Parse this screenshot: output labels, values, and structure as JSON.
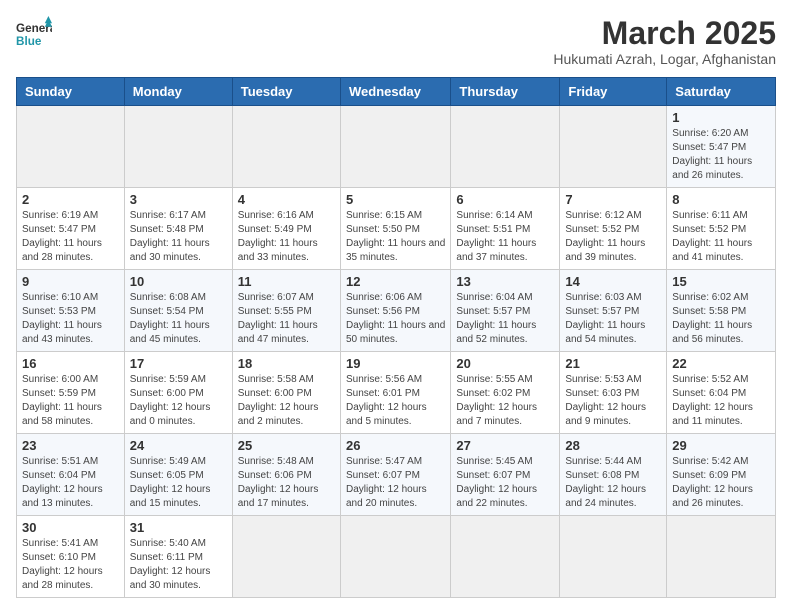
{
  "logo": {
    "text_general": "General",
    "text_blue": "Blue"
  },
  "header": {
    "month_title": "March 2025",
    "subtitle": "Hukumati Azrah, Logar, Afghanistan"
  },
  "weekdays": [
    "Sunday",
    "Monday",
    "Tuesday",
    "Wednesday",
    "Thursday",
    "Friday",
    "Saturday"
  ],
  "weeks": [
    [
      {
        "date": "",
        "info": ""
      },
      {
        "date": "",
        "info": ""
      },
      {
        "date": "",
        "info": ""
      },
      {
        "date": "",
        "info": ""
      },
      {
        "date": "",
        "info": ""
      },
      {
        "date": "",
        "info": ""
      },
      {
        "date": "1",
        "info": "Sunrise: 6:20 AM\nSunset: 5:47 PM\nDaylight: 11 hours and 26 minutes."
      }
    ],
    [
      {
        "date": "2",
        "info": "Sunrise: 6:19 AM\nSunset: 5:47 PM\nDaylight: 11 hours and 28 minutes."
      },
      {
        "date": "3",
        "info": "Sunrise: 6:17 AM\nSunset: 5:48 PM\nDaylight: 11 hours and 30 minutes."
      },
      {
        "date": "4",
        "info": "Sunrise: 6:16 AM\nSunset: 5:49 PM\nDaylight: 11 hours and 33 minutes."
      },
      {
        "date": "5",
        "info": "Sunrise: 6:15 AM\nSunset: 5:50 PM\nDaylight: 11 hours and 35 minutes."
      },
      {
        "date": "6",
        "info": "Sunrise: 6:14 AM\nSunset: 5:51 PM\nDaylight: 11 hours and 37 minutes."
      },
      {
        "date": "7",
        "info": "Sunrise: 6:12 AM\nSunset: 5:52 PM\nDaylight: 11 hours and 39 minutes."
      },
      {
        "date": "8",
        "info": "Sunrise: 6:11 AM\nSunset: 5:52 PM\nDaylight: 11 hours and 41 minutes."
      }
    ],
    [
      {
        "date": "9",
        "info": "Sunrise: 6:10 AM\nSunset: 5:53 PM\nDaylight: 11 hours and 43 minutes."
      },
      {
        "date": "10",
        "info": "Sunrise: 6:08 AM\nSunset: 5:54 PM\nDaylight: 11 hours and 45 minutes."
      },
      {
        "date": "11",
        "info": "Sunrise: 6:07 AM\nSunset: 5:55 PM\nDaylight: 11 hours and 47 minutes."
      },
      {
        "date": "12",
        "info": "Sunrise: 6:06 AM\nSunset: 5:56 PM\nDaylight: 11 hours and 50 minutes."
      },
      {
        "date": "13",
        "info": "Sunrise: 6:04 AM\nSunset: 5:57 PM\nDaylight: 11 hours and 52 minutes."
      },
      {
        "date": "14",
        "info": "Sunrise: 6:03 AM\nSunset: 5:57 PM\nDaylight: 11 hours and 54 minutes."
      },
      {
        "date": "15",
        "info": "Sunrise: 6:02 AM\nSunset: 5:58 PM\nDaylight: 11 hours and 56 minutes."
      }
    ],
    [
      {
        "date": "16",
        "info": "Sunrise: 6:00 AM\nSunset: 5:59 PM\nDaylight: 11 hours and 58 minutes."
      },
      {
        "date": "17",
        "info": "Sunrise: 5:59 AM\nSunset: 6:00 PM\nDaylight: 12 hours and 0 minutes."
      },
      {
        "date": "18",
        "info": "Sunrise: 5:58 AM\nSunset: 6:00 PM\nDaylight: 12 hours and 2 minutes."
      },
      {
        "date": "19",
        "info": "Sunrise: 5:56 AM\nSunset: 6:01 PM\nDaylight: 12 hours and 5 minutes."
      },
      {
        "date": "20",
        "info": "Sunrise: 5:55 AM\nSunset: 6:02 PM\nDaylight: 12 hours and 7 minutes."
      },
      {
        "date": "21",
        "info": "Sunrise: 5:53 AM\nSunset: 6:03 PM\nDaylight: 12 hours and 9 minutes."
      },
      {
        "date": "22",
        "info": "Sunrise: 5:52 AM\nSunset: 6:04 PM\nDaylight: 12 hours and 11 minutes."
      }
    ],
    [
      {
        "date": "23",
        "info": "Sunrise: 5:51 AM\nSunset: 6:04 PM\nDaylight: 12 hours and 13 minutes."
      },
      {
        "date": "24",
        "info": "Sunrise: 5:49 AM\nSunset: 6:05 PM\nDaylight: 12 hours and 15 minutes."
      },
      {
        "date": "25",
        "info": "Sunrise: 5:48 AM\nSunset: 6:06 PM\nDaylight: 12 hours and 17 minutes."
      },
      {
        "date": "26",
        "info": "Sunrise: 5:47 AM\nSunset: 6:07 PM\nDaylight: 12 hours and 20 minutes."
      },
      {
        "date": "27",
        "info": "Sunrise: 5:45 AM\nSunset: 6:07 PM\nDaylight: 12 hours and 22 minutes."
      },
      {
        "date": "28",
        "info": "Sunrise: 5:44 AM\nSunset: 6:08 PM\nDaylight: 12 hours and 24 minutes."
      },
      {
        "date": "29",
        "info": "Sunrise: 5:42 AM\nSunset: 6:09 PM\nDaylight: 12 hours and 26 minutes."
      }
    ],
    [
      {
        "date": "30",
        "info": "Sunrise: 5:41 AM\nSunset: 6:10 PM\nDaylight: 12 hours and 28 minutes."
      },
      {
        "date": "31",
        "info": "Sunrise: 5:40 AM\nSunset: 6:11 PM\nDaylight: 12 hours and 30 minutes."
      },
      {
        "date": "",
        "info": ""
      },
      {
        "date": "",
        "info": ""
      },
      {
        "date": "",
        "info": ""
      },
      {
        "date": "",
        "info": ""
      },
      {
        "date": "",
        "info": ""
      }
    ]
  ]
}
